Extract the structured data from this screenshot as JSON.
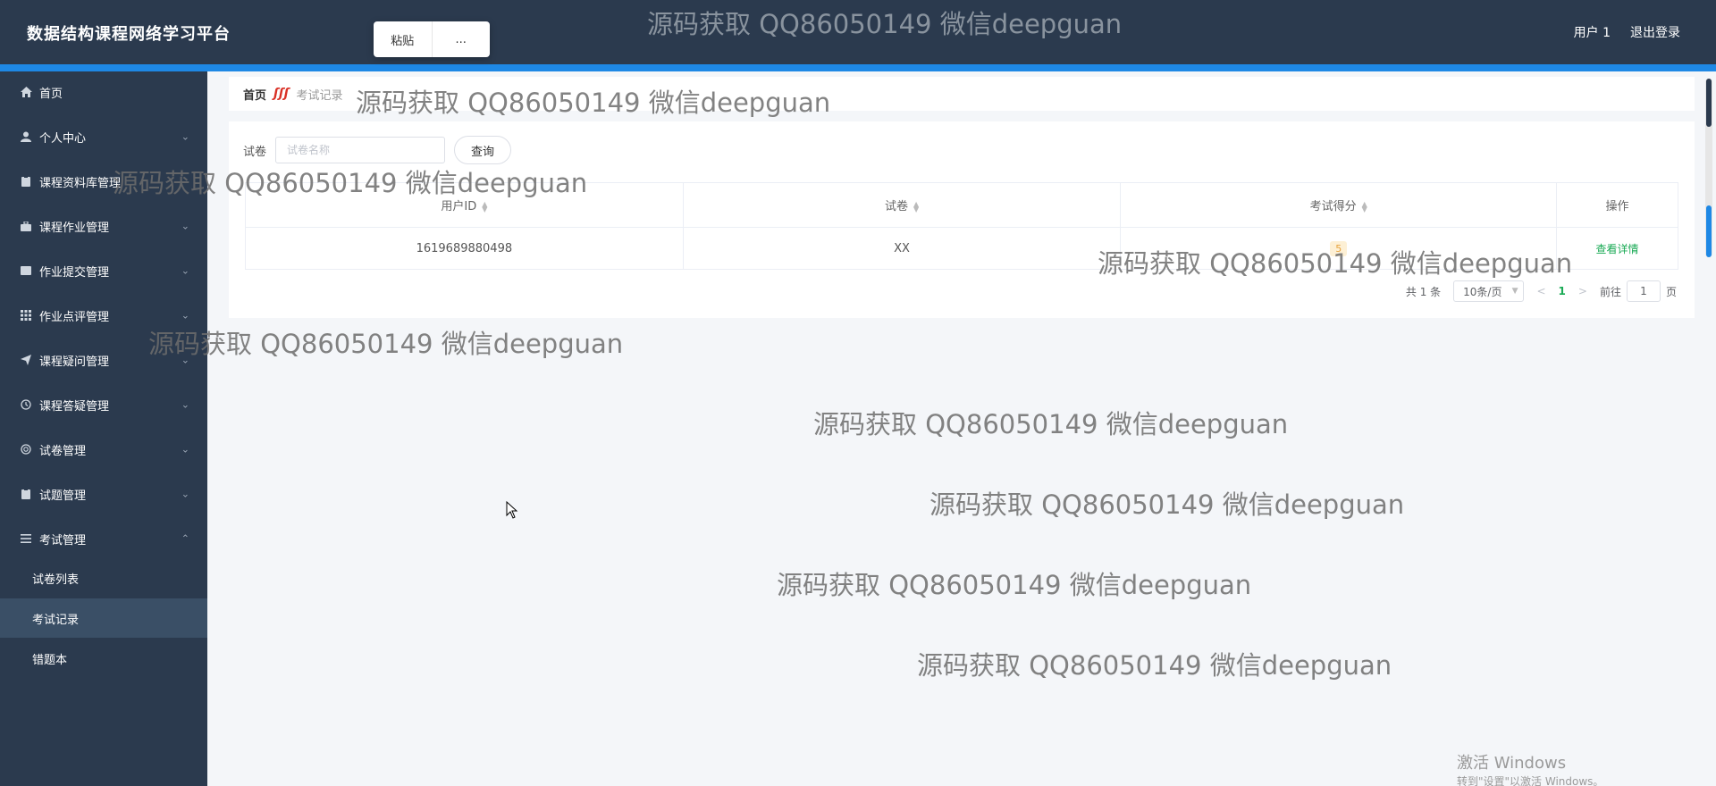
{
  "header": {
    "title": "数据结构课程网络学习平台",
    "user_label": "用户 1",
    "logout_label": "退出登录"
  },
  "context_popup": {
    "paste_label": "粘贴",
    "more_label": "..."
  },
  "sidebar": {
    "items": [
      {
        "label": "首页",
        "icon": "home-icon",
        "chevron": ""
      },
      {
        "label": "个人中心",
        "icon": "user-icon",
        "chevron": "⌄"
      },
      {
        "label": "课程资料库管理",
        "icon": "clipboard-icon",
        "chevron": ""
      },
      {
        "label": "课程作业管理",
        "icon": "briefcase-icon",
        "chevron": "⌄"
      },
      {
        "label": "作业提交管理",
        "icon": "folder-icon",
        "chevron": "⌄"
      },
      {
        "label": "作业点评管理",
        "icon": "grid-icon",
        "chevron": "⌄"
      },
      {
        "label": "课程疑问管理",
        "icon": "send-icon",
        "chevron": "⌄"
      },
      {
        "label": "课程答疑管理",
        "icon": "clock-icon",
        "chevron": "⌄"
      },
      {
        "label": "试卷管理",
        "icon": "circle-icon",
        "chevron": "⌄"
      },
      {
        "label": "试题管理",
        "icon": "clipboard-icon",
        "chevron": "⌄"
      },
      {
        "label": "考试管理",
        "icon": "list-icon",
        "chevron": "⌃"
      }
    ],
    "subitems": [
      {
        "label": "试卷列表"
      },
      {
        "label": "考试记录"
      },
      {
        "label": "错题本"
      }
    ]
  },
  "breadcrumb": {
    "home": "首页",
    "separator": "ʃʃʃ",
    "current": "考试记录"
  },
  "search": {
    "label": "试卷",
    "placeholder": "试卷名称",
    "button_label": "查询"
  },
  "table": {
    "columns": [
      "用户ID",
      "试卷",
      "考试得分",
      "操作"
    ],
    "rows": [
      {
        "user_id": "1619689880498",
        "paper": "XX",
        "score": "5",
        "action": "查看详情"
      }
    ]
  },
  "pagination": {
    "total": "共 1 条",
    "page_size": "10条/页",
    "current_page": "1",
    "goto_label": "前往",
    "goto_value": "1",
    "page_suffix": "页"
  },
  "watermark": "源码获取 QQ86050149 微信deepguan",
  "windows_activation": {
    "title": "激活 Windows",
    "subtitle": "转到\"设置\"以激活 Windows。"
  },
  "colors": {
    "sidebar_bg": "#2b3a4e",
    "accent": "#1e88e5",
    "active_link": "#1aaa55"
  }
}
